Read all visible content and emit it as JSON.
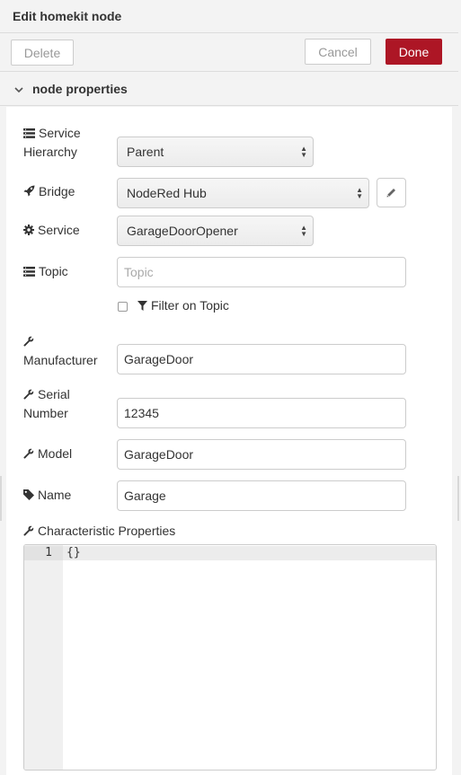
{
  "tray": {
    "title": "Edit homekit node"
  },
  "toolbar": {
    "delete_label": "Delete",
    "cancel_label": "Cancel",
    "done_label": "Done"
  },
  "section": {
    "title": "node properties"
  },
  "form": {
    "service_hierarchy": {
      "label_line1": "Service",
      "label_line2": "Hierarchy",
      "value": "Parent"
    },
    "bridge": {
      "label": "Bridge",
      "value": "NodeRed Hub"
    },
    "service": {
      "label": "Service",
      "value": "GarageDoorOpener"
    },
    "topic": {
      "label": "Topic",
      "placeholder": "Topic",
      "value": ""
    },
    "filter_on_topic": {
      "label": "Filter on Topic",
      "checked": false
    },
    "manufacturer": {
      "label": "Manufacturer",
      "value": "GarageDoor"
    },
    "serial_number": {
      "label_line1": "Serial",
      "label_line2": "Number",
      "value": "12345"
    },
    "model": {
      "label": "Model",
      "value": "GarageDoor"
    },
    "name": {
      "label": "Name",
      "value": "Garage"
    },
    "characteristic_properties": {
      "label": "Characteristic Properties",
      "line_number": "1",
      "code": "{}"
    }
  },
  "colors": {
    "done_button": "#ad1625",
    "panel_bg": "#ffffff",
    "tray_bg": "#f3f3f3"
  },
  "icons": [
    "list-icon",
    "rocket-icon",
    "gear-icon",
    "wrench-icon",
    "tag-icon",
    "filter-icon",
    "pencil-icon",
    "chevron-down-icon"
  ]
}
